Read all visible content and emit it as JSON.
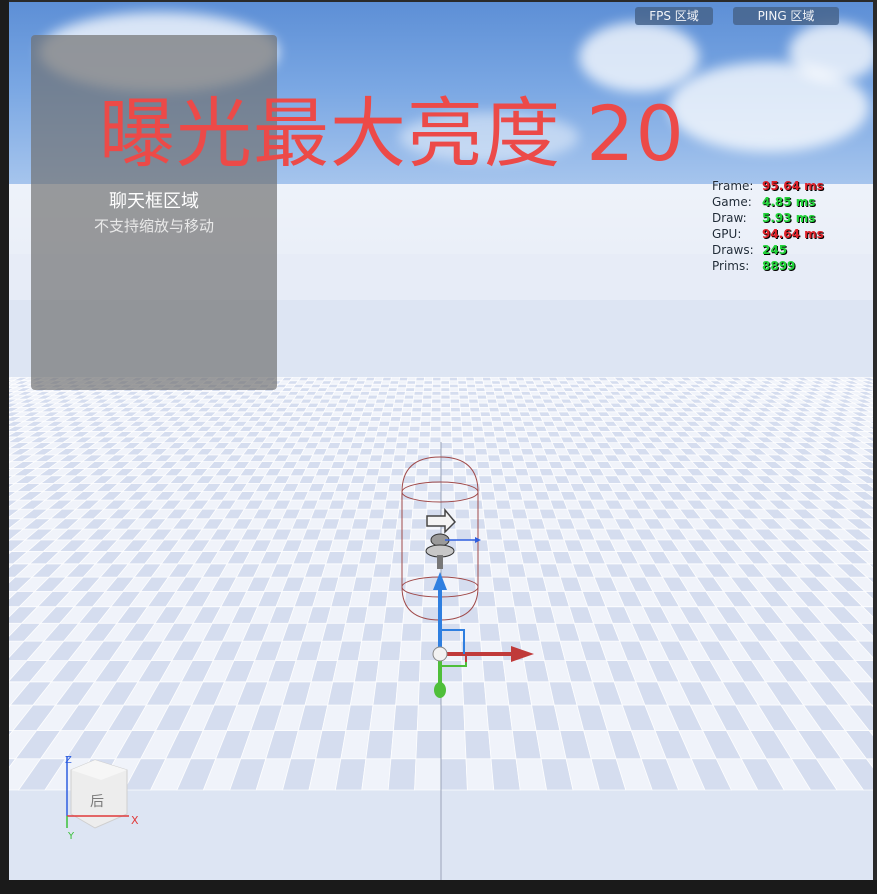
{
  "overlay": {
    "exposure_text": "曝光最大亮度 20",
    "exposure_color": "#ec4a48"
  },
  "top_buttons": {
    "fps": "FPS 区域",
    "ping": "PING 区域"
  },
  "chat_panel": {
    "title": "聊天框区域",
    "subtitle": "不支持缩放与移动"
  },
  "stats": [
    {
      "label": "Frame:",
      "value": "95.64 ms",
      "color": "#e0222a"
    },
    {
      "label": "Game:",
      "value": "4.85 ms",
      "color": "#22d43a"
    },
    {
      "label": "Draw:",
      "value": "5.93 ms",
      "color": "#22d43a"
    },
    {
      "label": "GPU:",
      "value": "94.64 ms",
      "color": "#e0222a"
    },
    {
      "label": "Draws:",
      "value": "245",
      "color": "#22d43a"
    },
    {
      "label": "Prims:",
      "value": "8899",
      "color": "#22d43a"
    }
  ],
  "view_cube": {
    "face_label": "后",
    "axis_z": "Z",
    "axis_x": "X",
    "axis_y": "Y"
  },
  "colors": {
    "axis_x": "#c03a3a",
    "axis_y": "#4fbf3a",
    "axis_z": "#2f7fe0",
    "capsule": "#a04a4a"
  }
}
